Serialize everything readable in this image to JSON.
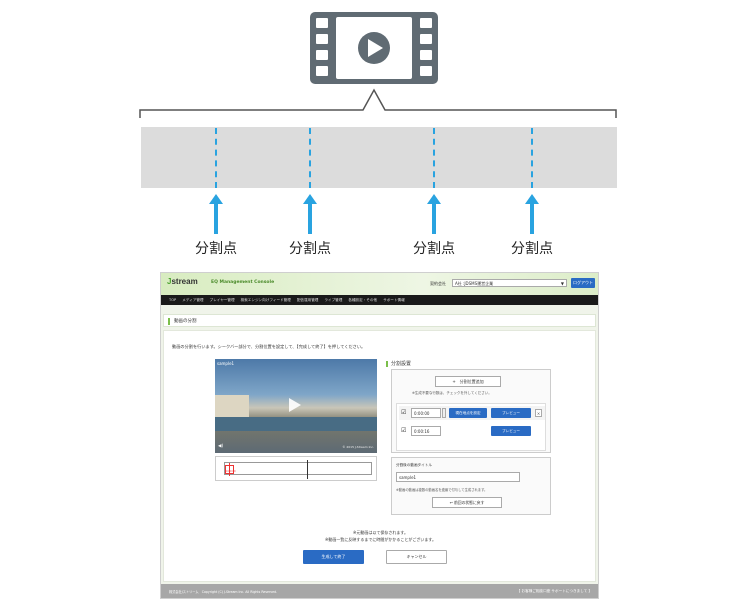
{
  "diagram": {
    "split_labels": [
      "分割点",
      "分割点",
      "分割点",
      "分割点"
    ],
    "colors": {
      "accent": "#29a3e0",
      "bar": "#dcdcdc",
      "icon": "#606b73"
    }
  },
  "screenshot": {
    "header": {
      "logo_prefix": "J",
      "logo_text": "stream",
      "console_title": "EQ Management Console",
      "contract_label": "契約会社",
      "contract_value": "A社 :JDSMS運営企業",
      "logout_label": "ログアウト"
    },
    "nav": {
      "items": [
        "TOP",
        "メディア管理",
        "プレイヤー管理",
        "検索エンジン向けフィード管理",
        "配信運用管理",
        "ライブ管理",
        "各種設定・その他",
        "サポート情報"
      ]
    },
    "page_title": "動画の分割",
    "instruction": "動画の分割を行います。シークバー部分で、分割位置を設定して、【完成して終了】を押してください。",
    "video": {
      "title": "sample1",
      "volume_icon": "◀)",
      "credit": "© 2015 J-Stream Inc."
    },
    "scrub": {
      "marker_time": "0:00:00"
    },
    "split_settings": {
      "heading": "分割設置",
      "add_button": "+　分割位置追加",
      "add_note": "※生成不要な行数は、チェックを外してください。",
      "rows": [
        {
          "time": "0:00:00",
          "set_button": "現在地点を設定",
          "preview_button": "プレビュー",
          "close": "×"
        },
        {
          "time": "0:00:16",
          "preview_button": "プレビュー"
        }
      ]
    },
    "title_box": {
      "label": "分割後の動画タイトル",
      "value": "sample1",
      "note": "※動画の動画は複数の動画名を連番で付与して生成されます。",
      "reset_button": "前回の状態に戻す"
    },
    "footer_notes": [
      "※元動画は以て保存されます。",
      "※動画一覧に反映するまでに時間がかかることがございます。"
    ],
    "save_button": "生成して終了",
    "cancel_button": "キャンセル",
    "footer": {
      "copyright": "株式会社Jストリーム　Copyright (C) J-Stream Inc. All Rights Reserved.",
      "contact": "【 お客様ご相談口座 サポートにつきまして 】"
    }
  }
}
